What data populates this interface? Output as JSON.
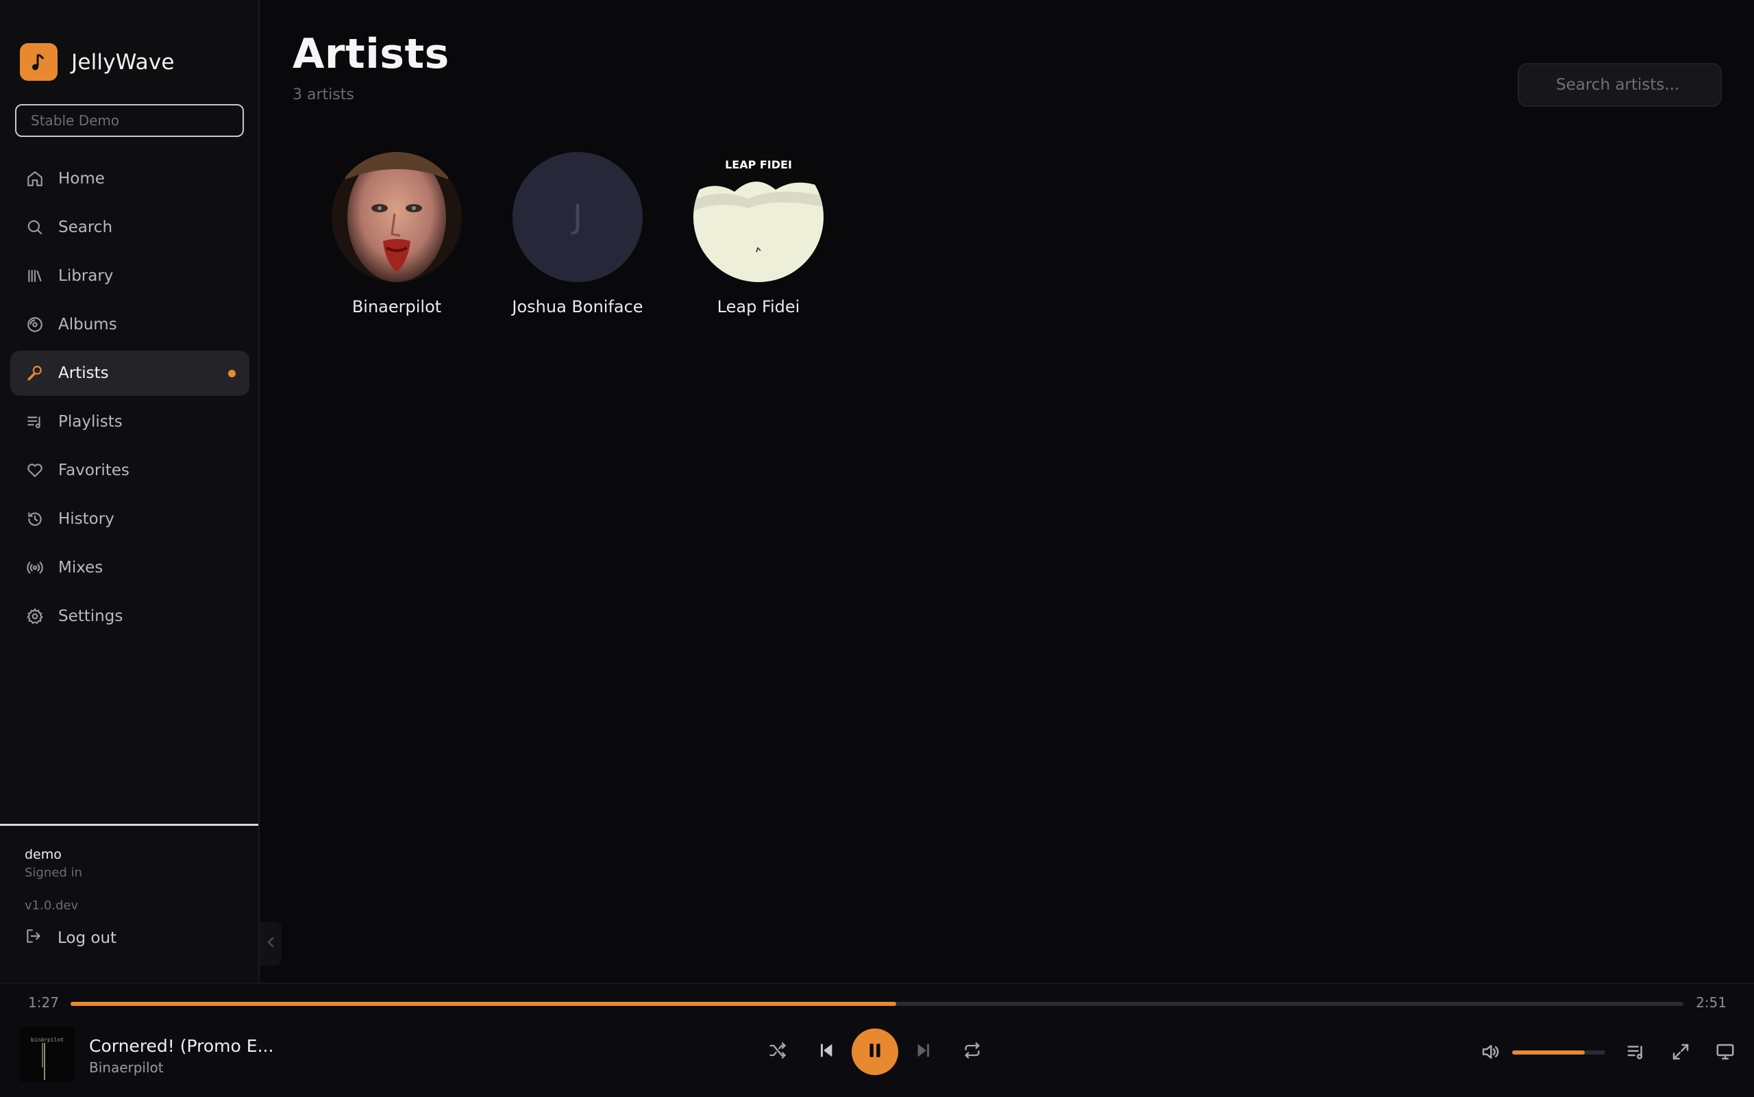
{
  "app": {
    "name": "JellyWave",
    "accent": "#e8892f"
  },
  "sidebar": {
    "server_select": "Stable Demo",
    "items": [
      {
        "label": "Home",
        "icon": "home-icon"
      },
      {
        "label": "Search",
        "icon": "search-icon"
      },
      {
        "label": "Library",
        "icon": "library-icon"
      },
      {
        "label": "Albums",
        "icon": "disc-icon"
      },
      {
        "label": "Artists",
        "icon": "microphone-icon",
        "active": true
      },
      {
        "label": "Playlists",
        "icon": "playlist-icon"
      },
      {
        "label": "Favorites",
        "icon": "heart-icon"
      },
      {
        "label": "History",
        "icon": "history-icon"
      },
      {
        "label": "Mixes",
        "icon": "radio-icon"
      },
      {
        "label": "Settings",
        "icon": "gear-icon"
      }
    ],
    "user": {
      "name": "demo",
      "status": "Signed in"
    },
    "version": "v1.0.dev",
    "logout_label": "Log out"
  },
  "main": {
    "title": "Artists",
    "subtitle": "3 artists",
    "search_placeholder": "Search artists...",
    "artists": [
      {
        "name": "Binaerpilot",
        "avatar": "photo"
      },
      {
        "name": "Joshua Boniface",
        "avatar": "letter",
        "initial": "J"
      },
      {
        "name": "Leap Fidei",
        "avatar": "cover",
        "cover_text": "LEAP FIDEI"
      }
    ]
  },
  "player": {
    "current_time": "1:27",
    "total_time": "2:51",
    "progress": 0.512,
    "volume": 0.78,
    "track_title": "Cornered! (Promo E...",
    "track_artist": "Binaerpilot",
    "art_text": "binärpilot",
    "state": "playing"
  }
}
